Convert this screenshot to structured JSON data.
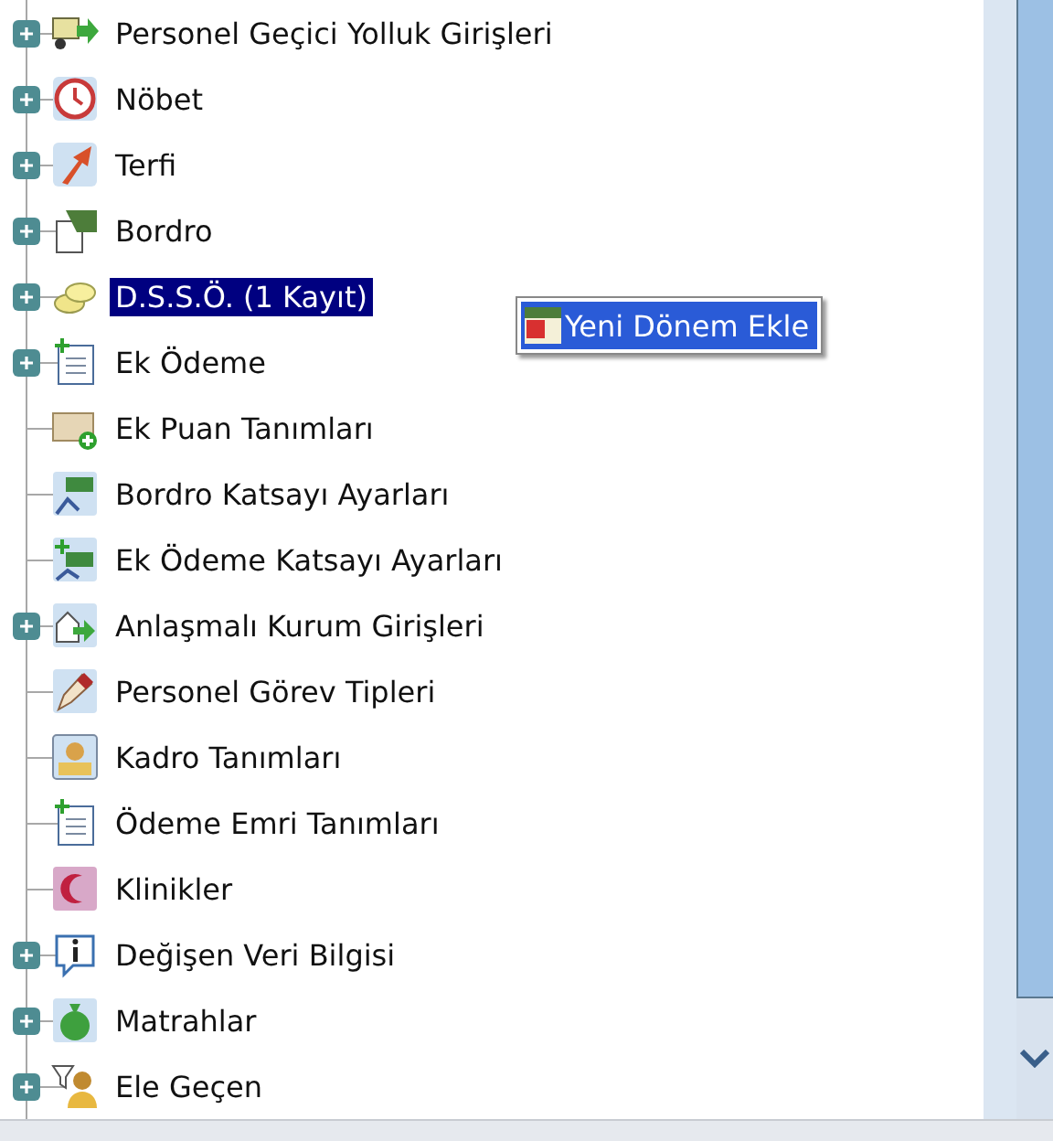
{
  "tree": {
    "items": [
      {
        "label": "Personel Geçici Yolluk Girişleri",
        "expandable": true,
        "selected": false
      },
      {
        "label": "Nöbet",
        "expandable": true,
        "selected": false
      },
      {
        "label": "Terfi",
        "expandable": true,
        "selected": false
      },
      {
        "label": "Bordro",
        "expandable": true,
        "selected": false
      },
      {
        "label": "D.S.S.Ö. (1 Kayıt)",
        "expandable": true,
        "selected": true
      },
      {
        "label": "Ek Ödeme",
        "expandable": true,
        "selected": false
      },
      {
        "label": "Ek Puan Tanımları",
        "expandable": false,
        "selected": false
      },
      {
        "label": "Bordro Katsayı Ayarları",
        "expandable": false,
        "selected": false
      },
      {
        "label": "Ek Ödeme Katsayı Ayarları",
        "expandable": false,
        "selected": false
      },
      {
        "label": "Anlaşmalı Kurum Girişleri",
        "expandable": true,
        "selected": false
      },
      {
        "label": "Personel Görev Tipleri",
        "expandable": false,
        "selected": false
      },
      {
        "label": "Kadro Tanımları",
        "expandable": false,
        "selected": false
      },
      {
        "label": "Ödeme Emri Tanımları",
        "expandable": false,
        "selected": false
      },
      {
        "label": "Klinikler",
        "expandable": false,
        "selected": false
      },
      {
        "label": "Değişen Veri Bilgisi",
        "expandable": true,
        "selected": false
      },
      {
        "label": "Matrahlar",
        "expandable": true,
        "selected": false
      },
      {
        "label": "Ele Geçen",
        "expandable": true,
        "selected": false
      }
    ]
  },
  "context_menu": {
    "items": [
      {
        "label": "Yeni Dönem Ekle",
        "selected": true
      }
    ]
  }
}
